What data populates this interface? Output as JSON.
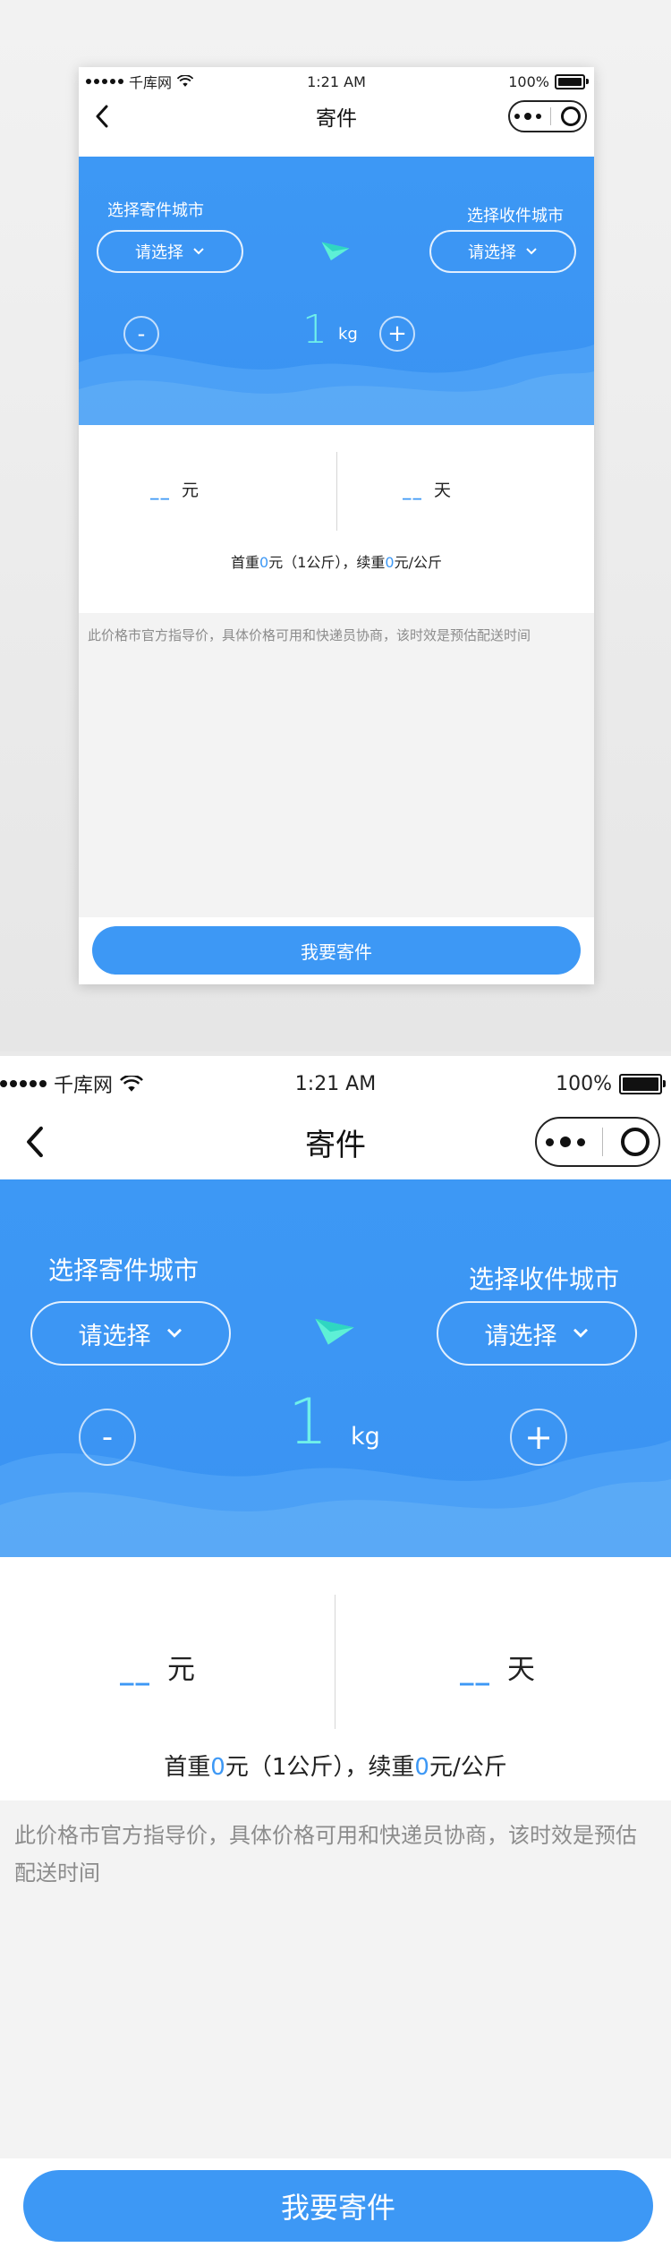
{
  "status_bar": {
    "carrier": "千库网",
    "time": "1:21 AM",
    "battery": "100%"
  },
  "nav": {
    "title": "寄件"
  },
  "sender": {
    "label": "选择寄件城市",
    "select_text": "请选择"
  },
  "receiver": {
    "label": "选择收件城市",
    "select_text": "请选择"
  },
  "weight": {
    "value": "1",
    "unit": "kg",
    "minus": "-",
    "plus": "+"
  },
  "result": {
    "price_blank": "__",
    "price_unit": "元",
    "days_blank": "__",
    "days_unit": "天"
  },
  "rate": {
    "first_label": "首重",
    "first_value": "0",
    "first_suffix": "元（1公斤），续重",
    "next_value": "0",
    "next_suffix": "元/公斤"
  },
  "notice": "此价格市官方指导价，具体价格可用和快递员协商，该时效是预估配送时间",
  "submit_label": "我要寄件",
  "colors": {
    "primary": "#3d98f5",
    "weight_accent": "#6ff0ea"
  }
}
